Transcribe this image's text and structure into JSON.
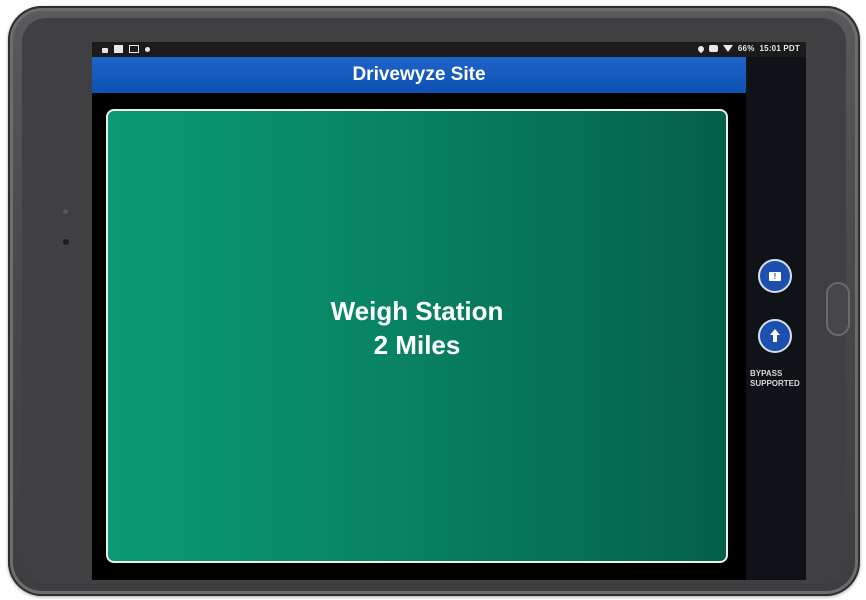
{
  "status_bar": {
    "battery": "66%",
    "time": "15:01 PDT"
  },
  "app": {
    "title": "Drivewyze Site"
  },
  "alert": {
    "line1": "Weigh Station",
    "line2": "2 Miles"
  },
  "side_rail": {
    "buttons": [
      {
        "icon": "report-icon"
      },
      {
        "icon": "arrow-up-icon"
      }
    ],
    "bypass_label_line1": "BYPASS",
    "bypass_label_line2": "SUPPORTED"
  },
  "colors": {
    "title_bar": "#0e51b4",
    "alert_panel_start": "#0a9a76",
    "alert_panel_end": "#046049",
    "rail_button": "#1c4fae"
  }
}
